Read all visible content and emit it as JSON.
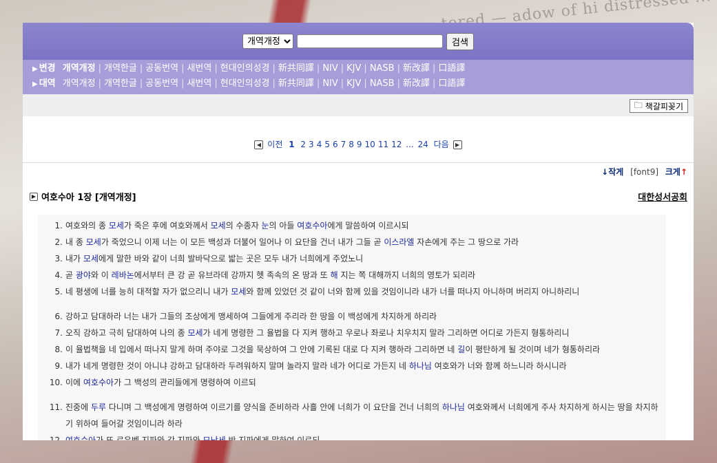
{
  "search": {
    "version_selected": "개역개정",
    "version_options": [
      "개역개정"
    ],
    "query": "",
    "button_label": "검색"
  },
  "version_rows": [
    {
      "lead": "변경",
      "items": [
        "개역개정",
        "개역한글",
        "공동번역",
        "새번역",
        "현대인의성경",
        "新共同譯",
        "NIV",
        "KJV",
        "NASB",
        "新改譯",
        "口語譯"
      ],
      "selected": 0
    },
    {
      "lead": "대역",
      "items": [
        "개역개정",
        "개역한글",
        "공동번역",
        "새번역",
        "현대인의성경",
        "新共同譯",
        "NIV",
        "KJV",
        "NASB",
        "新改譯",
        "口語譯"
      ],
      "selected": -1
    }
  ],
  "toolbar": {
    "bookmark_label": "책갈피꽂기"
  },
  "pager": {
    "prev_label": "이전",
    "current": "1",
    "pages": [
      "2",
      "3",
      "4",
      "5",
      "6",
      "7",
      "8",
      "9",
      "10",
      "11",
      "12"
    ],
    "ellipsis": "...",
    "last": "24",
    "next_label": "다음"
  },
  "font_control": {
    "smaller": "↓작게",
    "size": "[font9]",
    "larger": "크게",
    "larger_arrow": "↑"
  },
  "chapter": {
    "title": "여호수아 1장 [개역개정]",
    "publisher": "대한성서공회"
  },
  "colors": {
    "header": "#7b74c4",
    "version_bar": "#a59ed8",
    "name_highlight": "#1f2a9c"
  },
  "verses": [
    {
      "n": "1.",
      "parts": [
        [
          "여호와의 종 ",
          0
        ],
        [
          "모세",
          1
        ],
        [
          "가 죽은 후에 여호와께서 ",
          0
        ],
        [
          "모세",
          1
        ],
        [
          "의 수종자 ",
          0
        ],
        [
          "눈",
          1
        ],
        [
          "의 아들 ",
          0
        ],
        [
          "여호수아",
          1
        ],
        [
          "에게 말씀하여 이르시되",
          0
        ]
      ]
    },
    {
      "n": "2.",
      "parts": [
        [
          "내 종 ",
          0
        ],
        [
          "모세",
          1
        ],
        [
          "가 죽었으니 이제 너는 이 모든 백성과 더불어 일어나 이 요단을 건너 내가 그들 곧 ",
          0
        ],
        [
          "이스라엘",
          1
        ],
        [
          " 자손에게 주는 그 땅으로 가라",
          0
        ]
      ]
    },
    {
      "n": "3.",
      "parts": [
        [
          "내가 ",
          0
        ],
        [
          "모세",
          1
        ],
        [
          "에게 말한 바와 같이 너희 발바닥으로 밟는 곳은 모두 내가 너희에게 주었노니",
          0
        ]
      ]
    },
    {
      "n": "4.",
      "parts": [
        [
          "곧 ",
          0
        ],
        [
          "광야",
          1
        ],
        [
          "와 이 ",
          0
        ],
        [
          "레바논",
          1
        ],
        [
          "에서부터 큰 강 곧 유브라데 강까지 헷 족속의 온 땅과 또 ",
          0
        ],
        [
          "해",
          1
        ],
        [
          " 지는 쪽 대해까지 너희의 영토가 되리라",
          0
        ]
      ]
    },
    {
      "n": "5.",
      "parts": [
        [
          "네 평생에 너를 능히 대적할 자가 없으리니 내가 ",
          0
        ],
        [
          "모세",
          1
        ],
        [
          "와 함께 있었던 것 같이 너와 함께 있을 것임이니라 내가 너를 떠나지 아니하며 버리지 아니하리니",
          0
        ]
      ]
    },
    {
      "n": "6.",
      "gap": true,
      "parts": [
        [
          "강하고 담대하라 너는 내가 그들의 조상에게 맹세하여 그들에게 주리라 한 땅을 이 백성에게 차지하게 하리라",
          0
        ]
      ]
    },
    {
      "n": "7.",
      "parts": [
        [
          "오직 강하고 극히 담대하여 나의 종 ",
          0
        ],
        [
          "모세",
          1
        ],
        [
          "가 네게 명령한 그 율법을 다 지켜 행하고 우로나 좌로나 치우치지 말라 그리하면 어디로 가든지 형통하리니",
          0
        ]
      ]
    },
    {
      "n": "8.",
      "parts": [
        [
          "이 율법책을 네 입에서 떠나지 말게 하며 주야로 그것을 묵상하여 그 안에 기록된 대로 다 지켜 행하라 그리하면 네 ",
          0
        ],
        [
          "길",
          1
        ],
        [
          "이 평탄하게 될 것이며 네가 형통하리라",
          0
        ]
      ]
    },
    {
      "n": "9.",
      "parts": [
        [
          "내가 네게 명령한 것이 아니냐 강하고 담대하라 두려워하지 말며 놀라지 말라 네가 어디로 가든지 네 ",
          0
        ],
        [
          "하나님",
          1
        ],
        [
          " 여호와가 너와 함께 하느니라 하시니라",
          0
        ]
      ]
    },
    {
      "n": "10.",
      "parts": [
        [
          "이에 ",
          0
        ],
        [
          "여호수아",
          1
        ],
        [
          "가 그 백성의 관리들에게 명령하여 이르되",
          0
        ]
      ]
    },
    {
      "n": "11.",
      "gap": true,
      "parts": [
        [
          "진중에 ",
          0
        ],
        [
          "두루",
          1
        ],
        [
          " 다니며 그 백성에게 명령하여 이르기를 양식을 준비하라 사흘 안에 너희가 이 요단을 건너 너희의 ",
          0
        ],
        [
          "하나님",
          1
        ],
        [
          " 여호와께서 너희에게 주사 차지하게 하시는 땅을 차지하기 위하여 들어갈 것임이니라 하라",
          0
        ]
      ]
    },
    {
      "n": "12.",
      "parts": [
        [
          "여호수아",
          1
        ],
        [
          "가 또 르우벤 지파와 갓 지파와 ",
          0
        ],
        [
          "므낫세",
          1
        ],
        [
          " 반 지파에게 말하여 이르되",
          0
        ]
      ]
    }
  ]
}
